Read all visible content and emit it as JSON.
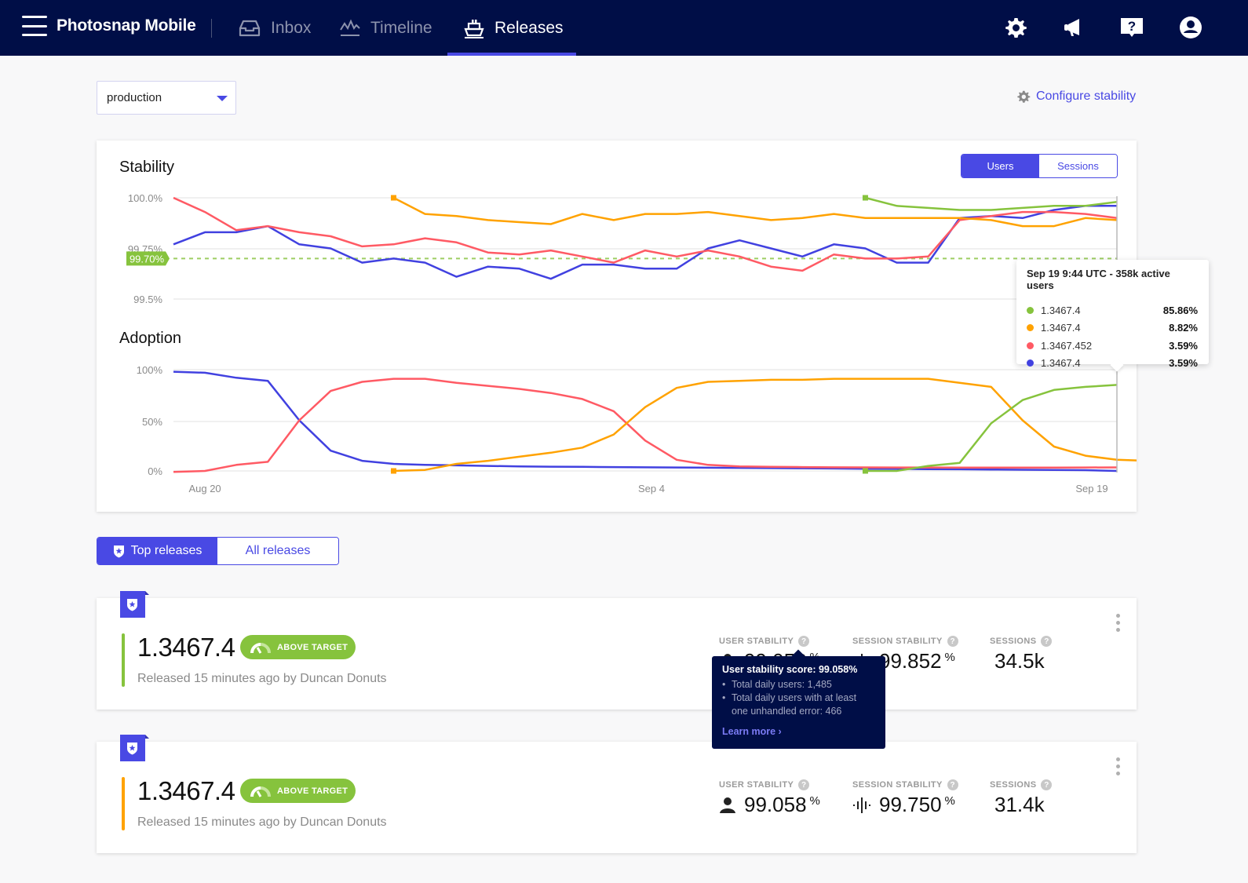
{
  "nav": {
    "app_name": "Photosnap Mobile",
    "items": [
      {
        "label": "Inbox",
        "icon": "inbox-icon",
        "active": false
      },
      {
        "label": "Timeline",
        "icon": "timeline-icon",
        "active": false
      },
      {
        "label": "Releases",
        "icon": "ship-icon",
        "active": true
      }
    ],
    "right_icons": [
      "gear-icon",
      "megaphone-icon",
      "help-icon",
      "user-account-icon"
    ]
  },
  "toolbar": {
    "environment": "production",
    "configure_label": "Configure stability"
  },
  "colors": {
    "accent": "#4949e4",
    "nav_bg": "#000e47",
    "green": "#86c33d",
    "orange": "#ffa200",
    "red": "#ff5a64",
    "blue": "#4141e0"
  },
  "stability_card": {
    "title": "Stability",
    "toggle": [
      "Users",
      "Sessions"
    ],
    "toggle_selected": "Users",
    "adoption_title": "Adoption"
  },
  "chart_data": [
    {
      "type": "line",
      "title": "Stability",
      "ylabel": "",
      "y_ticks": [
        "100.0%",
        "99.75%",
        "99.5%"
      ],
      "ylim": [
        99.5,
        100.0
      ],
      "target_line": {
        "value": 99.7,
        "label": "99.70%",
        "color": "#86c33d"
      },
      "x_count": 31,
      "series": [
        {
          "name": "1.3467.4 (blue)",
          "color": "#4141e0",
          "start": 0,
          "values": [
            99.77,
            99.83,
            99.83,
            99.86,
            99.77,
            99.75,
            99.68,
            99.7,
            99.68,
            99.61,
            99.66,
            99.65,
            99.6,
            99.67,
            99.67,
            99.65,
            99.65,
            99.75,
            99.79,
            99.75,
            99.71,
            99.77,
            99.75,
            99.68,
            99.68,
            99.9,
            99.91,
            99.9,
            99.94,
            99.96,
            99.96
          ]
        },
        {
          "name": "1.3467.452",
          "color": "#ff5a64",
          "start": 0,
          "values": [
            100.0,
            99.93,
            99.84,
            99.86,
            99.83,
            99.81,
            99.76,
            99.77,
            99.8,
            99.78,
            99.73,
            99.72,
            99.74,
            99.71,
            99.68,
            99.74,
            99.71,
            99.74,
            99.71,
            99.66,
            99.64,
            99.72,
            99.7,
            99.7,
            99.71,
            99.89,
            99.91,
            99.93,
            99.93,
            99.92,
            99.9
          ]
        },
        {
          "name": "1.3467.4 (orange)",
          "color": "#ffa200",
          "start": 7,
          "values": [
            100.0,
            99.92,
            99.91,
            99.89,
            99.88,
            99.87,
            99.92,
            99.89,
            99.92,
            99.92,
            99.93,
            99.91,
            99.89,
            99.9,
            99.92,
            99.9,
            99.9,
            99.9,
            99.9,
            99.89,
            99.86,
            99.86,
            99.9,
            99.89
          ]
        },
        {
          "name": "1.3467.4 (green)",
          "color": "#86c33d",
          "start": 22,
          "values": [
            100.0,
            99.96,
            99.95,
            99.94,
            99.94,
            99.95,
            99.96,
            99.96,
            99.98
          ]
        }
      ]
    },
    {
      "type": "line",
      "title": "Adoption",
      "y_ticks": [
        "100%",
        "50%",
        "0%"
      ],
      "ylim": [
        0,
        100
      ],
      "x_tick_labels": [
        {
          "label": "Aug 20",
          "index": 1
        },
        {
          "label": "Sep 4",
          "index": 15.2
        },
        {
          "label": "Sep 19",
          "index": 29.2
        }
      ],
      "x_count": 31,
      "series": [
        {
          "name": "1.3467.4 (blue)",
          "color": "#4141e0",
          "start": 0,
          "values": [
            98,
            97,
            92,
            89,
            50,
            20,
            10,
            7,
            6,
            5.5,
            5,
            4.5,
            4.2,
            4,
            3.8,
            3.6,
            3.4,
            3.2,
            3,
            2.8,
            2.6,
            2.4,
            2.2,
            2,
            1.8,
            1.6,
            1.4,
            1.2,
            1,
            0.8,
            0
          ]
        },
        {
          "name": "1.3467.452",
          "color": "#ff5a64",
          "start": 0,
          "values": [
            -1,
            0,
            6,
            9,
            50,
            79,
            88,
            91,
            91,
            87,
            84,
            81,
            77,
            71,
            59,
            30,
            11,
            6,
            4.5,
            4,
            3.8,
            3.6,
            3.5,
            3.4,
            3.4,
            3.3,
            3.3,
            3.3,
            3.3,
            3.4,
            3.5
          ]
        },
        {
          "name": "1.3467.4 (orange)",
          "color": "#ffa200",
          "start": 7,
          "values": [
            0,
            1,
            7,
            10,
            14,
            18,
            23,
            36,
            63,
            82,
            88,
            89,
            90,
            90,
            91,
            91,
            91,
            91,
            87,
            83,
            50,
            24,
            15,
            11,
            10
          ]
        },
        {
          "name": "1.3467.4 (green)",
          "color": "#86c33d",
          "start": 22,
          "values": [
            0,
            0,
            5,
            8,
            47,
            70,
            80,
            83,
            85
          ]
        }
      ]
    }
  ],
  "chart_tooltip": {
    "header": "Sep 19 9:44 UTC - 358k active users",
    "rows": [
      {
        "name": "1.3467.4",
        "value": "85.86%",
        "color": "#86c33d"
      },
      {
        "name": "1.3467.4",
        "value": "8.82%",
        "color": "#ffa200"
      },
      {
        "name": "1.3467.452",
        "value": "3.59%",
        "color": "#ff5a64"
      },
      {
        "name": "1.3467.4",
        "value": "3.59%",
        "color": "#4141e0"
      }
    ]
  },
  "release_tabs": {
    "top": "Top releases",
    "all": "All releases",
    "selected": "Top releases"
  },
  "releases": [
    {
      "version": "1.3467.4",
      "status": "ABOVE TARGET",
      "subtitle": "Released 15 minutes ago by Duncan Donuts",
      "bar_color": "#86c33d",
      "user_stability_label": "USER STABILITY",
      "user_stability": "99.058",
      "session_stability_label": "SESSION STABILITY",
      "session_stability": "99.852",
      "sessions_label": "SESSIONS",
      "sessions": "34.5k",
      "unit": "%"
    },
    {
      "version": "1.3467.4",
      "status": "ABOVE TARGET",
      "subtitle": "Released 15 minutes ago by Duncan Donuts",
      "bar_color": "#ffa200",
      "user_stability_label": "USER STABILITY",
      "user_stability": "99.058",
      "session_stability_label": "SESSION STABILITY",
      "session_stability": "99.750",
      "sessions_label": "SESSIONS",
      "sessions": "31.4k",
      "unit": "%"
    }
  ],
  "stability_tooltip": {
    "title": "User stability score: 99.058%",
    "bullets": [
      "Total daily users: 1,485",
      "Total daily users with at least one unhandled error: 466"
    ],
    "link": "Learn more ›"
  }
}
